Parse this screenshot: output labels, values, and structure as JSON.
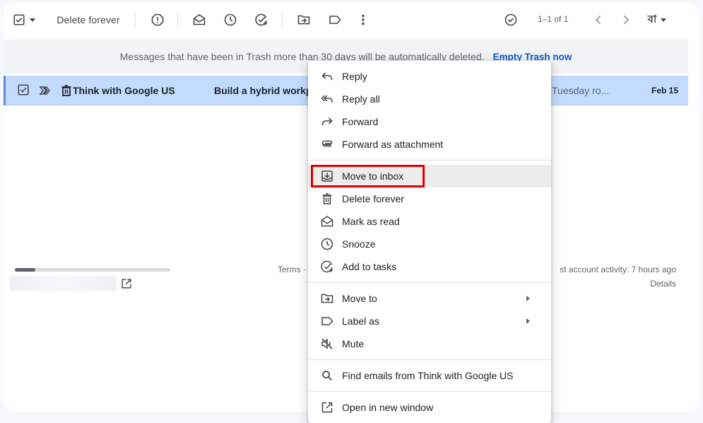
{
  "toolbar": {
    "delete_forever_label": "Delete forever",
    "pager": "1–1 of 1",
    "lang_label": "বা"
  },
  "banner": {
    "message": "Messages that have been in Trash more than 30 days will be automatically deleted.",
    "empty_trash": "Empty Trash now"
  },
  "row": {
    "sender": "Think with Google US",
    "subject": "Build a hybrid workpl",
    "snippet": "Tuesday ro...",
    "date": "Feb 15"
  },
  "footer": {
    "terms": "Terms ·",
    "activity": "st account activity: 7 hours ago",
    "details": "Details"
  },
  "menu": {
    "reply": "Reply",
    "reply_all": "Reply all",
    "forward": "Forward",
    "forward_attachment": "Forward as attachment",
    "move_to_inbox": "Move to inbox",
    "delete_forever": "Delete forever",
    "mark_as_read": "Mark as read",
    "snooze": "Snooze",
    "add_to_tasks": "Add to tasks",
    "move_to": "Move to",
    "label_as": "Label as",
    "mute": "Mute",
    "find_emails": "Find emails from Think with Google US",
    "open_new_window": "Open in new window"
  },
  "colors": {
    "selected_row": "#c2dbff",
    "link": "#0b57d0",
    "highlight": "#e00000"
  }
}
